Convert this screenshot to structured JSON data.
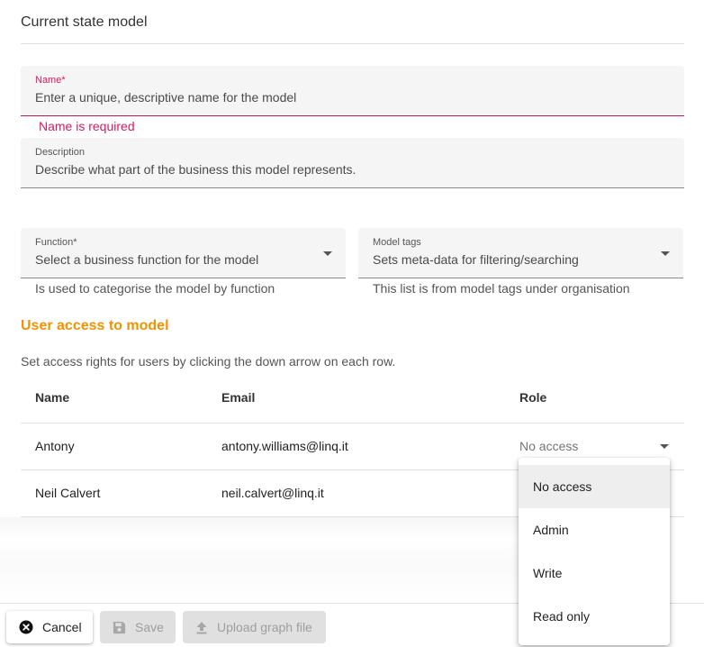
{
  "page": {
    "title": "Current state model"
  },
  "form": {
    "name": {
      "label": "Name*",
      "placeholder": "Enter a unique, descriptive name for the model",
      "error": "Name is required"
    },
    "description": {
      "label": "Description",
      "placeholder": "Describe what part of the business this model represents."
    },
    "function": {
      "label": "Function*",
      "placeholder": "Select a business function for the model",
      "hint": "Is used to categorise the model by function"
    },
    "tags": {
      "label": "Model tags",
      "placeholder": "Sets meta-data for filtering/searching",
      "hint": "This list is from model tags under organisation"
    }
  },
  "access": {
    "heading": "User access to model",
    "description": "Set access rights for users by clicking the down arrow on each row.",
    "columns": [
      "Name",
      "Email",
      "Role"
    ],
    "rows": [
      {
        "name": "Antony",
        "email": "antony.williams@linq.it",
        "role": "No access"
      },
      {
        "name": "Neil Calvert",
        "email": "neil.calvert@linq.it",
        "role": ""
      }
    ],
    "heading_color": "#f39200"
  },
  "role_menu": {
    "options": [
      "No access",
      "Admin",
      "Write",
      "Read only"
    ],
    "selected": "No access"
  },
  "footer": {
    "cancel_label": "Cancel",
    "save_label": "Save",
    "upload_label": "Upload graph file"
  },
  "icons": {
    "cancel": "close-circle-icon",
    "save": "floppy-disk-icon",
    "upload": "upload-icon",
    "dropdown": "caret-down-icon"
  },
  "colors": {
    "error": "#d81b60",
    "accent": "#f39200"
  }
}
